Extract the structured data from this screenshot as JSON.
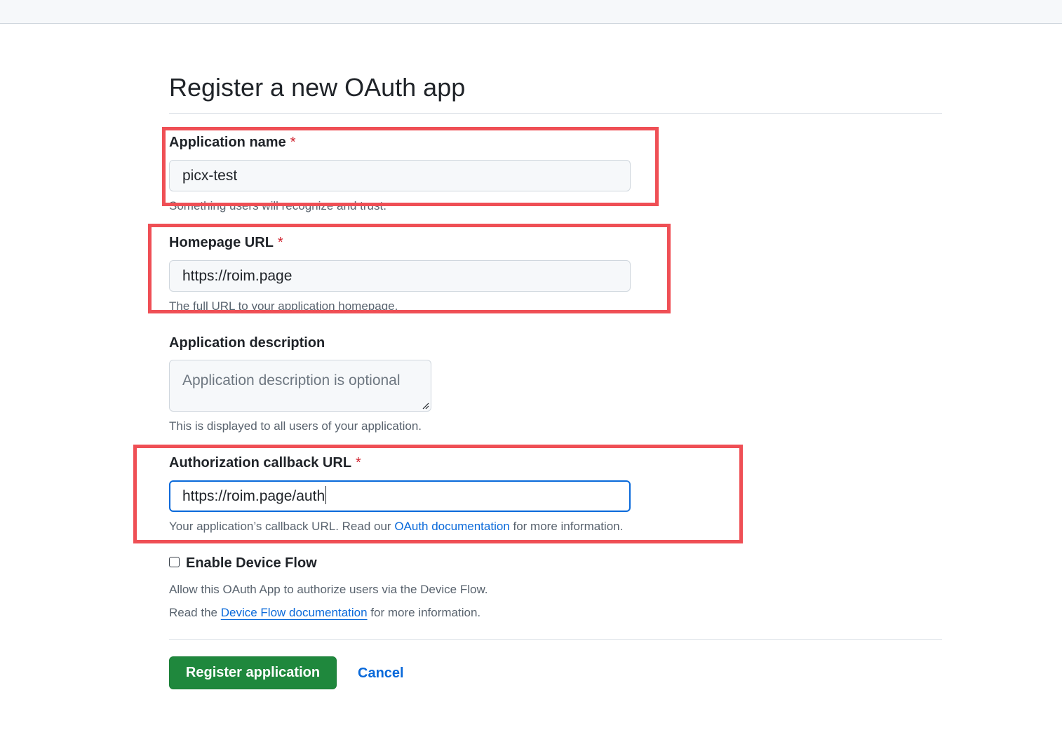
{
  "title": "Register a new OAuth app",
  "fields": {
    "app_name": {
      "label": "Application name",
      "required_mark": "*",
      "value": "picx-test",
      "hint": "Something users will recognize and trust."
    },
    "homepage": {
      "label": "Homepage URL",
      "required_mark": "*",
      "value": "https://roim.page",
      "hint": "The full URL to your application homepage."
    },
    "description": {
      "label": "Application description",
      "placeholder": "Application description is optional",
      "hint": "This is displayed to all users of your application."
    },
    "callback": {
      "label": "Authorization callback URL",
      "required_mark": "*",
      "value": "https://roim.page/auth",
      "hint_prefix": "Your application’s callback URL. Read our ",
      "hint_link": "OAuth documentation",
      "hint_suffix": " for more information."
    }
  },
  "device_flow": {
    "label": "Enable Device Flow",
    "checked": false,
    "desc": "Allow this OAuth App to authorize users via the Device Flow.",
    "read_prefix": "Read the ",
    "read_link": "Device Flow documentation",
    "read_suffix": " for more information."
  },
  "actions": {
    "register": "Register application",
    "cancel": "Cancel"
  },
  "colors": {
    "primary_button": "#1f883d",
    "link": "#0969da",
    "required": "#cf222e",
    "annotation_box": "#ef4f55",
    "focus_ring": "#0969da"
  }
}
